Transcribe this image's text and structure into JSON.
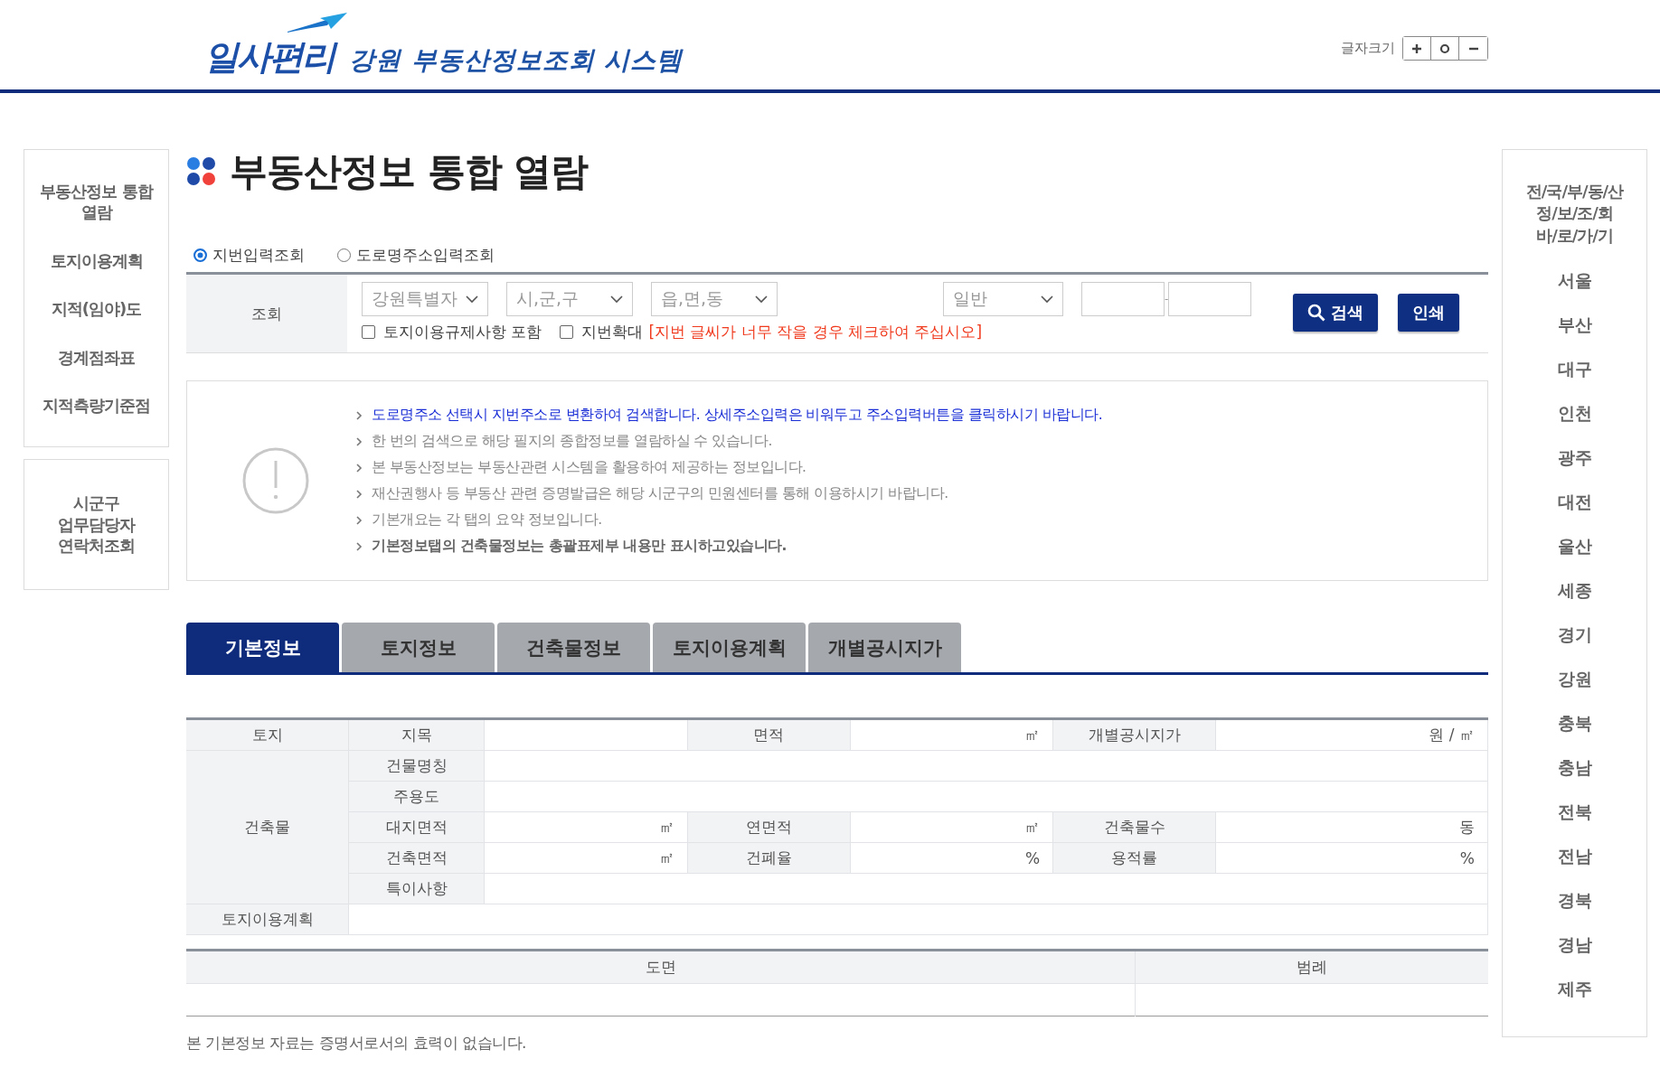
{
  "header": {
    "logo_text": "일사편리",
    "site_title": "강원 부동산정보조회 시스템",
    "font_size": {
      "label": "글자크기",
      "buttons": [
        {
          "kind": "plus"
        },
        {
          "kind": "reset"
        },
        {
          "kind": "minus"
        }
      ]
    }
  },
  "left_sidebar": {
    "menu": [
      "부동산정보 통합 열람",
      "토지이용계획",
      "지적(임야)도",
      "경계점좌표",
      "지적측량기준점"
    ],
    "contact": "시군구 업무담당자 연락처조회"
  },
  "page_title": "부동산정보 통합 열람",
  "search_modes": [
    {
      "label": "지번입력조회",
      "selected": true
    },
    {
      "label": "도로명주소입력조회",
      "selected": false
    }
  ],
  "search": {
    "label": "조회",
    "selects": [
      "강원특별자",
      "시,군,구",
      "읍,면,동"
    ],
    "lot_type": "일반",
    "separator": "-",
    "options": [
      {
        "label": "토지이용규제사항 포함",
        "checked": false
      },
      {
        "label": "지번확대",
        "checked": false
      }
    ],
    "warning": "[지번 글씨가 너무 작을 경우 체크하여 주십시오]",
    "search_button": "검색",
    "print_button": "인쇄"
  },
  "notices": [
    {
      "kind": "link",
      "text": "도로명주소 선택시 지번주소로 변환하여 검색합니다. 상세주소입력은 비워두고 주소입력버튼을 클릭하시기 바랍니다."
    },
    {
      "kind": "normal",
      "text": "한 번의 검색으로 해당 필지의 종합정보를 열람하실 수 있습니다."
    },
    {
      "kind": "normal",
      "text": "본 부동산정보는 부동산관련 시스템을 활용하여 제공하는 정보입니다."
    },
    {
      "kind": "normal",
      "text": "재산권행사 등 부동산 관련 증명발급은 해당 시군구의 민원센터를 통해 이용하시기 바랍니다."
    },
    {
      "kind": "normal",
      "text": "기본개요는 각 탭의 요약 정보입니다."
    },
    {
      "kind": "bold",
      "text": "기본정보탭의 건축물정보는 총괄표제부 내용만 표시하고있습니다."
    }
  ],
  "tabs": [
    {
      "label": "기본정보",
      "selected": true
    },
    {
      "label": "토지정보",
      "selected": false
    },
    {
      "label": "건축물정보",
      "selected": false
    },
    {
      "label": "토지이용계획",
      "selected": false
    },
    {
      "label": "개별공시지가",
      "selected": false
    }
  ],
  "table": {
    "rows": [
      [
        {
          "kind": "head",
          "text": "토지"
        },
        {
          "kind": "head",
          "text": "지목"
        },
        {
          "kind": "value"
        },
        {
          "kind": "head",
          "text": "면적"
        },
        {
          "kind": "value",
          "text": "㎡"
        },
        {
          "kind": "head",
          "text": "개별공시지가"
        },
        {
          "kind": "value",
          "text": "원 / ㎡"
        }
      ],
      [
        {
          "kind": "head",
          "text": "건축물",
          "rowspan": 5
        },
        {
          "kind": "head",
          "text": "건물명칭"
        },
        {
          "kind": "value",
          "colspan": 5
        }
      ],
      [
        {
          "kind": "head",
          "text": "주용도"
        },
        {
          "kind": "value",
          "colspan": 5
        }
      ],
      [
        {
          "kind": "head",
          "text": "대지면적"
        },
        {
          "kind": "value",
          "text": "㎡"
        },
        {
          "kind": "head",
          "text": "연면적"
        },
        {
          "kind": "value",
          "text": "㎡"
        },
        {
          "kind": "head",
          "text": "건축물수"
        },
        {
          "kind": "value",
          "text": "동"
        }
      ],
      [
        {
          "kind": "head",
          "text": "건축면적"
        },
        {
          "kind": "value",
          "text": "㎡"
        },
        {
          "kind": "head",
          "text": "건폐율"
        },
        {
          "kind": "value",
          "text": "%"
        },
        {
          "kind": "head",
          "text": "용적률"
        },
        {
          "kind": "value",
          "text": "%"
        }
      ],
      [
        {
          "kind": "head",
          "text": "특이사항"
        },
        {
          "kind": "value",
          "colspan": 5
        }
      ],
      [
        {
          "kind": "head",
          "text": "토지이용계획"
        },
        {
          "kind": "value",
          "colspan": 6
        }
      ]
    ]
  },
  "map_table": {
    "columns": [
      "도면",
      "범례"
    ]
  },
  "footnote": "본 기본정보 자료는 증명서로서의 효력이 없습니다.",
  "right_sidebar": {
    "title": "전/국/부/동/산 정/보/조/회 바/로/가/기",
    "regions": [
      "서울",
      "부산",
      "대구",
      "인천",
      "광주",
      "대전",
      "울산",
      "세종",
      "경기",
      "강원",
      "충북",
      "충남",
      "전북",
      "전남",
      "경북",
      "경남",
      "제주"
    ]
  }
}
